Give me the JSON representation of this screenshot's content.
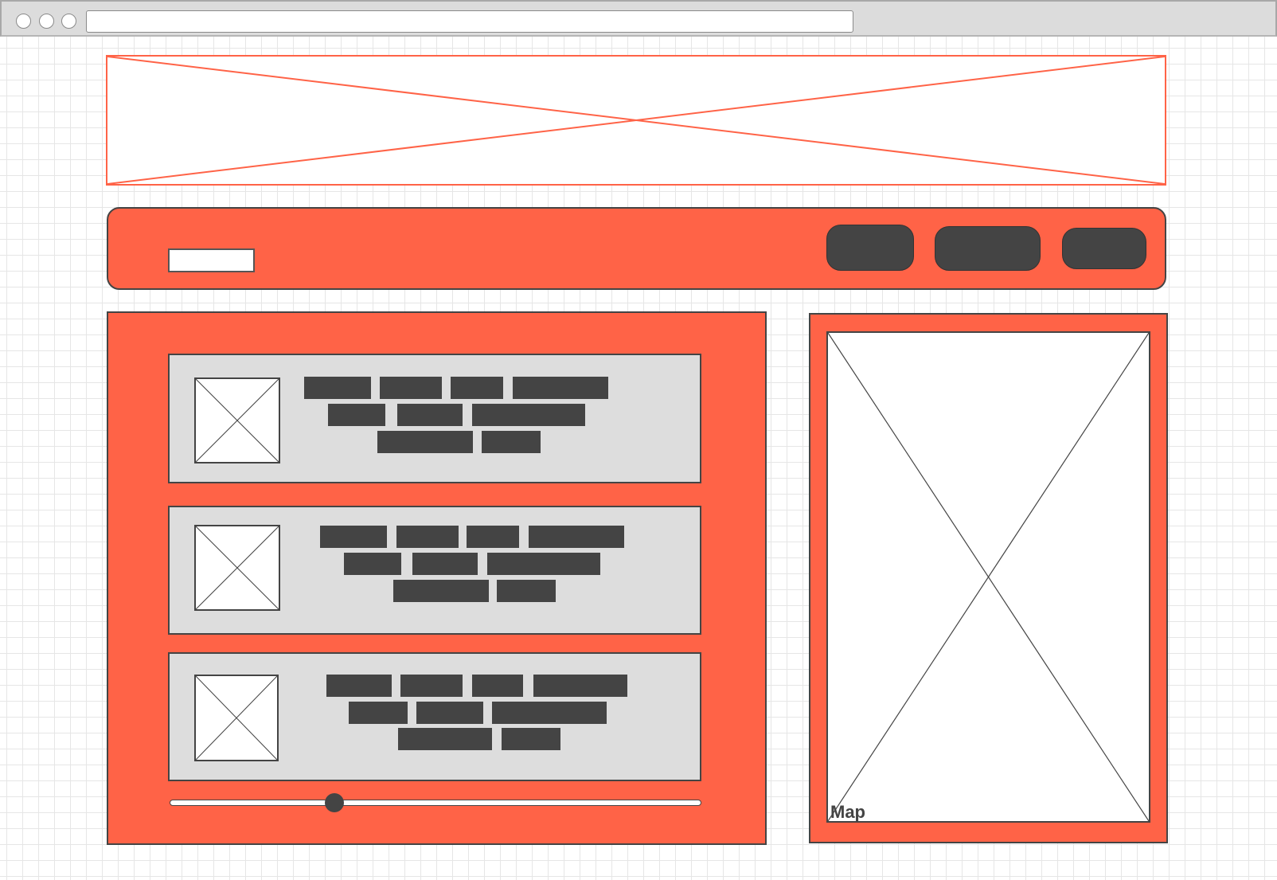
{
  "chrome": {
    "window_buttons": [
      "close",
      "minimize",
      "maximize"
    ],
    "url": ""
  },
  "banner": {
    "kind": "image-placeholder",
    "border_color": "#ff6347"
  },
  "nav": {
    "search": {
      "value": "",
      "placeholder": ""
    },
    "buttons": [
      {
        "name": "nav-button-1",
        "label": ""
      },
      {
        "name": "nav-button-2",
        "label": ""
      },
      {
        "name": "nav-button-3",
        "label": ""
      }
    ]
  },
  "results": {
    "items": [
      {
        "thumbnail": "image-placeholder",
        "text_lines": 3
      },
      {
        "thumbnail": "image-placeholder",
        "text_lines": 3
      },
      {
        "thumbnail": "image-placeholder",
        "text_lines": 3
      }
    ],
    "slider": {
      "value": 0.31
    }
  },
  "map": {
    "label": "Map"
  },
  "colors": {
    "accent": "#ff6347",
    "dark": "#444444",
    "card": "#dddddd",
    "grid": "#e6e6e6"
  }
}
